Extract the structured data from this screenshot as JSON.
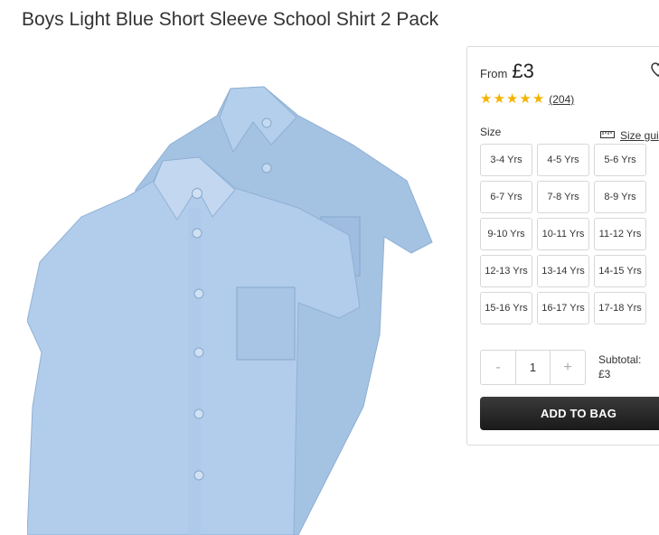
{
  "product": {
    "title": "Boys Light Blue Short Sleeve School Shirt 2 Pack"
  },
  "pricing": {
    "from_label": "From",
    "price": "£3"
  },
  "rating": {
    "stars": 5,
    "review_count": "(204)"
  },
  "size": {
    "label": "Size",
    "guide_label": "Size gui",
    "options": [
      "3-4 Yrs",
      "4-5 Yrs",
      "5-6 Yrs",
      "6-7 Yrs",
      "7-8 Yrs",
      "8-9 Yrs",
      "9-10 Yrs",
      "10-11 Yrs",
      "11-12 Yrs",
      "12-13 Yrs",
      "13-14 Yrs",
      "14-15 Yrs",
      "15-16 Yrs",
      "16-17 Yrs",
      "17-18 Yrs"
    ]
  },
  "quantity": {
    "minus": "-",
    "value": "1",
    "plus": "+"
  },
  "subtotal": {
    "label": "Subtotal:",
    "value": "£3"
  },
  "actions": {
    "add_to_bag": "ADD TO BAG"
  },
  "icons": {
    "wishlist": "heart-icon",
    "size_guide": "ruler-icon",
    "star": "star-icon"
  },
  "colors": {
    "shirt": "#a9c7e6",
    "star": "#f5b301",
    "button": "#222222"
  }
}
